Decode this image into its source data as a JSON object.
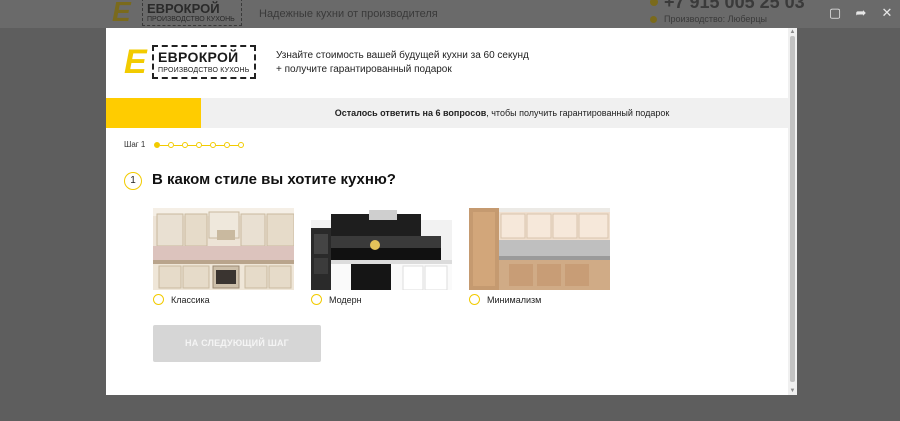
{
  "background": {
    "brand_line1": "ЕВРОКРОЙ",
    "brand_line2": "ПРОИЗВОДСТВО КУХОНЬ",
    "tagline": "Надежные кухни от производителя",
    "phone": "+7 915 005 25 03",
    "production": "Производство: Люберцы"
  },
  "window_controls": {
    "maximize": "▢",
    "share": "➦",
    "close": "✕"
  },
  "modal": {
    "logo_letter": "E",
    "logo_line1": "ЕВРОКРОЙ",
    "logo_line2": "ПРОИЗВОДСТВО КУХОНЬ",
    "header_line1": "Узнайте стоимость вашей будущей кухни за 60 секунд",
    "header_line2": "+ получите гарантированный подарок",
    "progress": {
      "fraction": 0.14,
      "text_bold": "Осталось ответить на 6 вопросов",
      "text_rest": ", чтобы получить гарантированный подарок"
    },
    "step_label": "Шаг 1",
    "step_count": 7,
    "question_number": "1",
    "question": "В каком стиле вы хотите кухню?",
    "options": [
      {
        "label": "Классика"
      },
      {
        "label": "Модерн"
      },
      {
        "label": "Минимализм"
      }
    ],
    "next_button": "НА СЛЕДУЮЩИЙ ШАГ"
  }
}
